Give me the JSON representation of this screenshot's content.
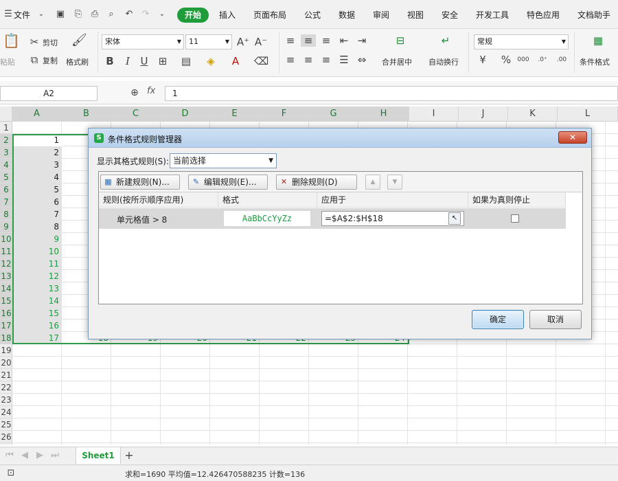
{
  "menubar": {
    "file_label": "文件",
    "tabs": [
      "开始",
      "插入",
      "页面布局",
      "公式",
      "数据",
      "审阅",
      "视图",
      "安全",
      "开发工具",
      "特色应用",
      "文档助手"
    ]
  },
  "ribbon": {
    "paste_label": "粘贴",
    "cut_label": "剪切",
    "copy_label": "复制",
    "format_painter_label": "格式刷",
    "font_name": "宋体",
    "font_size": "11",
    "merge_center_label": "合并居中",
    "wrap_text_label": "自动换行",
    "number_format": "常规",
    "conditional_format_label": "条件格式"
  },
  "formula_bar": {
    "name_box": "A2",
    "formula": "1"
  },
  "columns": [
    "A",
    "B",
    "C",
    "D",
    "E",
    "F",
    "G",
    "H",
    "I",
    "J",
    "K",
    "L"
  ],
  "rows": [
    "1",
    "2",
    "3",
    "4",
    "5",
    "6",
    "7",
    "8",
    "9",
    "10",
    "11",
    "12",
    "13",
    "14",
    "15",
    "16",
    "17",
    "18",
    "19",
    "20",
    "21",
    "22",
    "23",
    "24",
    "25",
    "26"
  ],
  "cells_a": [
    "1",
    "2",
    "3",
    "4",
    "5",
    "6",
    "7",
    "8",
    "9",
    "10",
    "11",
    "12",
    "13",
    "14",
    "15",
    "16",
    "17"
  ],
  "row18_partial": [
    "18",
    "19",
    "20",
    "21",
    "22",
    "23",
    "24"
  ],
  "sheet_tabs": {
    "sheet1": "Sheet1",
    "add": "+"
  },
  "status": {
    "summary": "求和=1690   平均值=12.426470588235   计数=136"
  },
  "dialog": {
    "title": "条件格式规则管理器",
    "show_rules_label": "显示其格式规则(S):",
    "show_rules_value": "当前选择",
    "new_rule": "新建规则(N)...",
    "edit_rule": "编辑规则(E)...",
    "delete_rule": "删除规则(D)",
    "headers": [
      "规则(按所示顺序应用)",
      "格式",
      "应用于",
      "如果为真则停止"
    ],
    "rule": {
      "name": "单元格值 > 8",
      "format_preview": "AaBbCcYyZz",
      "applies_to": "=$A$2:$H$18"
    },
    "ok": "确定",
    "cancel": "取消",
    "colors": {
      "title_bg": "#bcd3ee",
      "format_preview": "#1a9d3f"
    }
  },
  "colors": {
    "accent": "#1f9d3a",
    "selection": "#2e9a4a"
  }
}
